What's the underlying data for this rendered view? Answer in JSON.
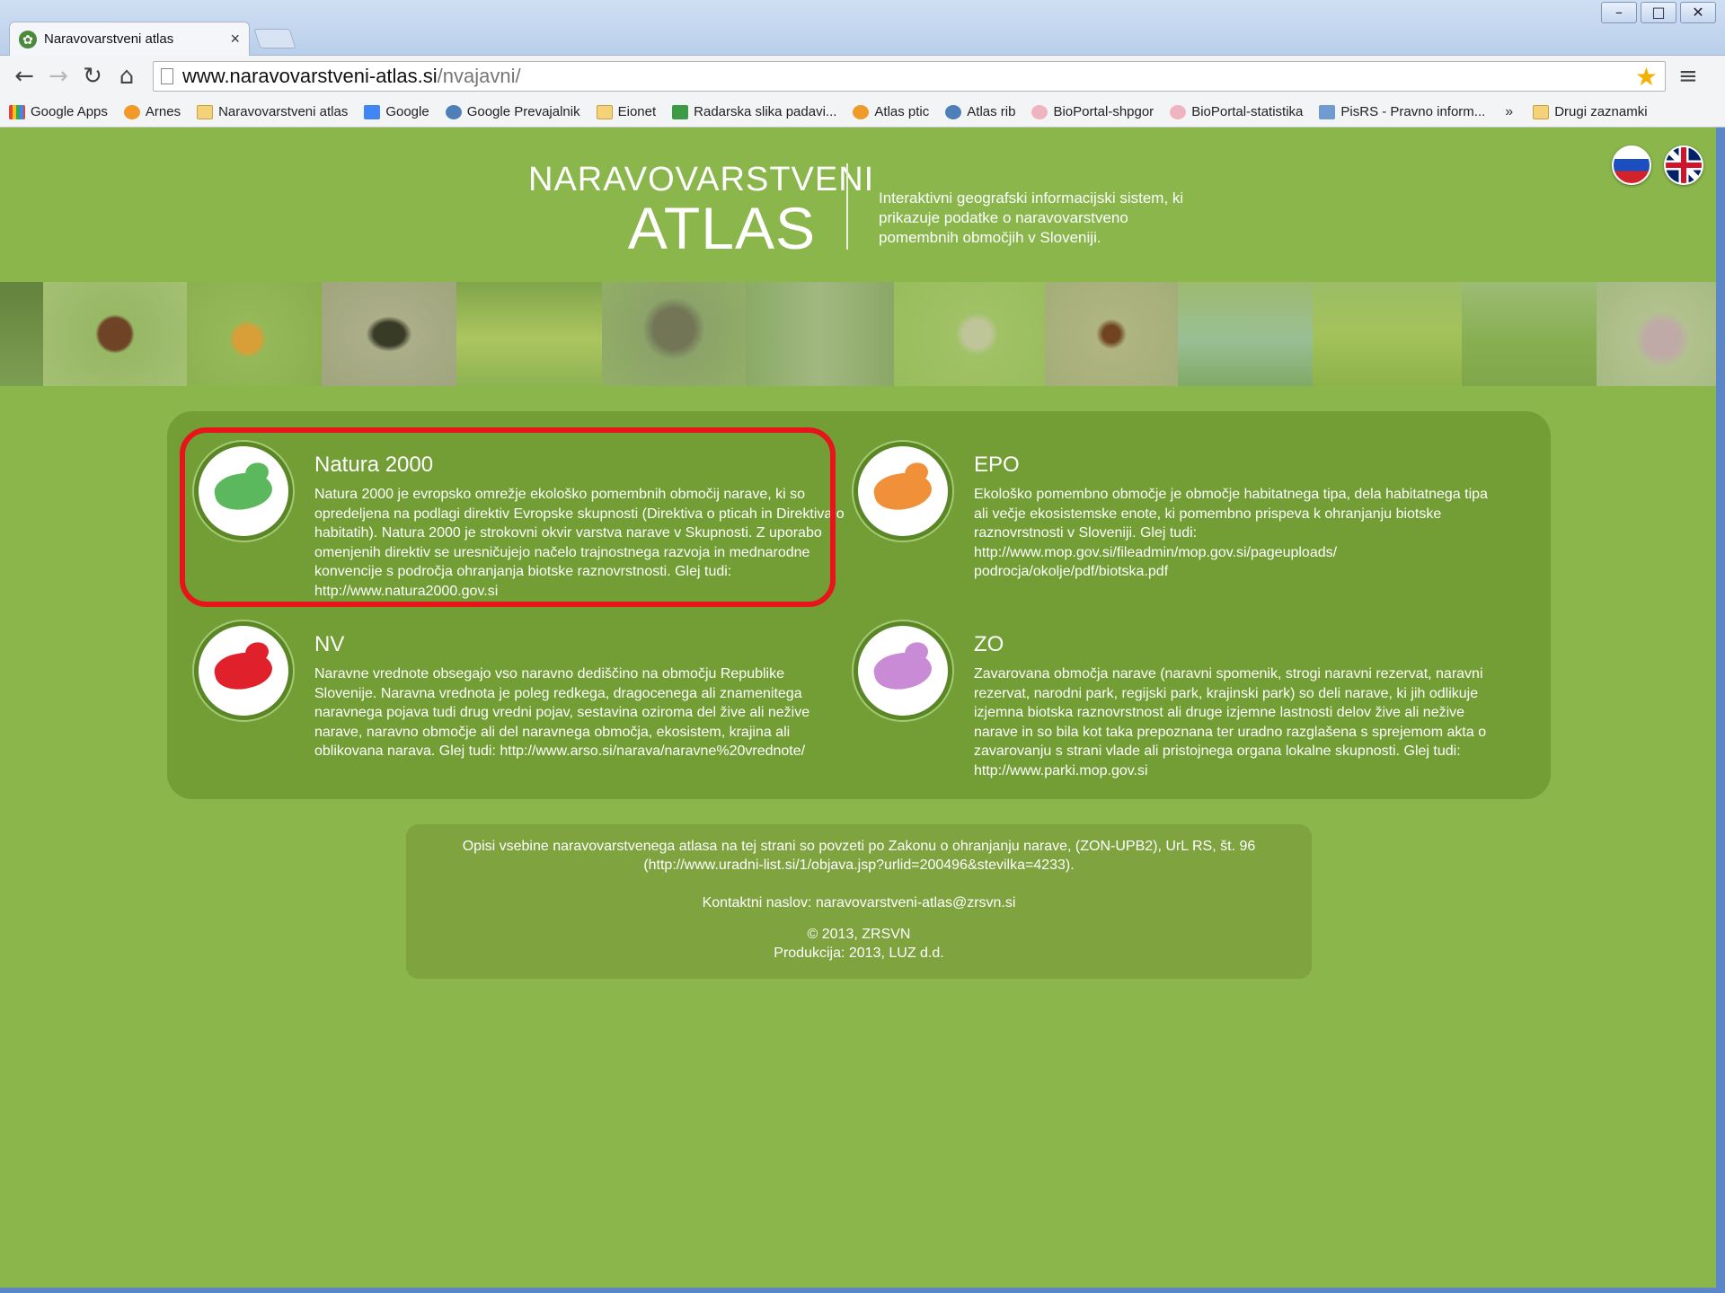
{
  "browser": {
    "tab_title": "Naravovarstveni atlas",
    "tab_close": "×",
    "url_host": "www.naravovarstveni-atlas.si",
    "url_path": "/nvajavni/",
    "window_controls": [
      "–",
      "□",
      "✕"
    ]
  },
  "bookmarks": [
    {
      "label": "Google Apps",
      "icon": "apps"
    },
    {
      "label": "Arnes",
      "icon": "orange"
    },
    {
      "label": "Naravovarstveni atlas",
      "icon": "folder"
    },
    {
      "label": "Google",
      "icon": "g"
    },
    {
      "label": "Google Prevajalnik",
      "icon": "blue"
    },
    {
      "label": "Eionet",
      "icon": "folder"
    },
    {
      "label": "Radarska slika padavi...",
      "icon": "green"
    },
    {
      "label": "Atlas ptic",
      "icon": "orange"
    },
    {
      "label": "Atlas rib",
      "icon": "blue"
    },
    {
      "label": "BioPortal-shpgor",
      "icon": "pink"
    },
    {
      "label": "BioPortal-statistika",
      "icon": "pink"
    },
    {
      "label": "PisRS - Pravno inform...",
      "icon": "shield"
    }
  ],
  "bookmarks_more": "»",
  "bookmarks_other": "Drugi zaznamki",
  "header": {
    "logo_line1": "NARAVOVARSTVENI",
    "logo_line2": "ATLAS",
    "tagline": "Interaktivni geografski informacijski sistem, ki prikazuje podatke o naravovarstveno pomembnih območjih v Sloveniji."
  },
  "items": {
    "natura": {
      "title": "Natura 2000",
      "body": "Natura 2000 je evropsko omrežje ekološko pomembnih območij narave, ki so opredeljena na podlagi direktiv Evropske skupnosti (Direktiva o pticah in Direktiva o habitatih). Natura 2000 je strokovni okvir varstva narave v Skupnosti. Z uporabo omenjenih direktiv se uresničujejo načelo trajnostnega razvoja in mednarodne konvencije s področja ohranjanja biotske raznovrstnosti. Glej tudi: http://www.natura2000.gov.si",
      "map_color": "#5cb85c"
    },
    "epo": {
      "title": "EPO",
      "body": "Ekološko pomembno območje je območje habitatnega tipa, dela habitatnega tipa ali večje ekosistemske enote, ki pomembno prispeva k ohranjanju biotske raznovrstnosti v Sloveniji. Glej tudi: http://www.mop.gov.si/fileadmin/mop.gov.si/pageuploads/ podrocja/okolje/pdf/biotska.pdf",
      "map_color": "#f0913a"
    },
    "nv": {
      "title": "NV",
      "body": "Naravne vrednote obsegajo vso naravno dediščino na območju Republike Slovenije. Naravna vrednota je poleg redkega, dragocenega ali znamenitega naravnega pojava tudi drug vredni pojav, sestavina oziroma del žive ali nežive narave, naravno območje ali del naravnega območja, ekosistem, krajina ali oblikovana narava. Glej tudi: http://www.arso.si/narava/naravne%20vrednote/",
      "map_color": "#e0202a"
    },
    "zo": {
      "title": "ZO",
      "body": "Zavarovana območja narave (naravni spomenik, strogi naravni rezervat, naravni rezervat, narodni park, regijski park, krajinski park) so deli narave, ki jih odlikuje izjemna biotska raznovrstnost ali druge izjemne lastnosti delov žive ali nežive narave in so bila kot taka prepoznana ter uradno razglašena s sprejemom akta o zavarovanju s strani vlade ali pristojnega organa lokalne skupnosti. Glej tudi: http://www.parki.mop.gov.si",
      "map_color": "#c98bd6"
    }
  },
  "footer": {
    "source_line1": "Opisi vsebine naravovarstvenega atlasa na tej strani so povzeti po Zakonu o ohranjanju narave, (ZON-UPB2), UrL RS, št. 96",
    "source_line2": "(http://www.uradni-list.si/1/objava.jsp?urlid=200496&stevilka=4233).",
    "contact": "Kontaktni naslov: naravovarstveni-atlas@zrsvn.si",
    "copyright": "© 2013, ZRSVN",
    "production": "Produkcija: 2013, LUZ d.d."
  },
  "colors": {
    "page_bg": "#8ab64c",
    "panel_bg": "#729e35",
    "highlight": "#e8141c"
  }
}
